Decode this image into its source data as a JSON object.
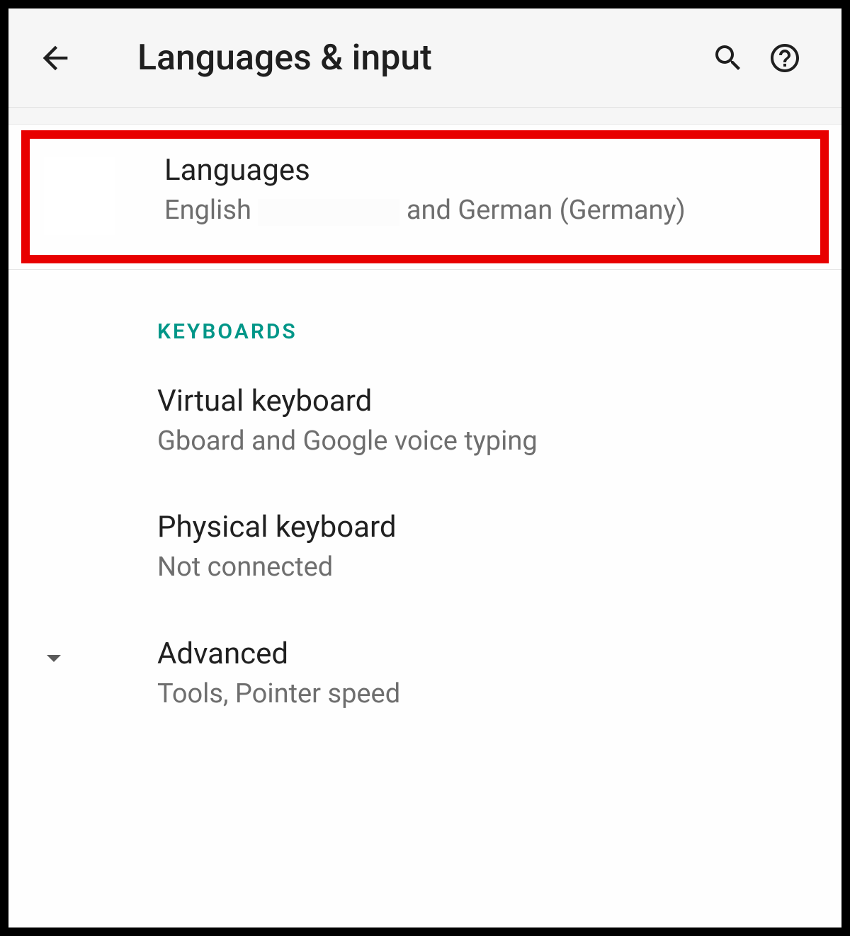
{
  "appbar": {
    "title": "Languages & input"
  },
  "languages_row": {
    "title": "Languages",
    "subtitle_prefix": "English ",
    "subtitle_suffix": " and German (Germany)"
  },
  "section_keyboards": "KEYBOARDS",
  "virtual_keyboard": {
    "title": "Virtual keyboard",
    "subtitle": "Gboard and Google voice typing"
  },
  "physical_keyboard": {
    "title": "Physical keyboard",
    "subtitle": "Not connected"
  },
  "advanced": {
    "title": "Advanced",
    "subtitle": "Tools, Pointer speed"
  },
  "colors": {
    "accent": "#009688",
    "highlight_border": "#e80000"
  }
}
